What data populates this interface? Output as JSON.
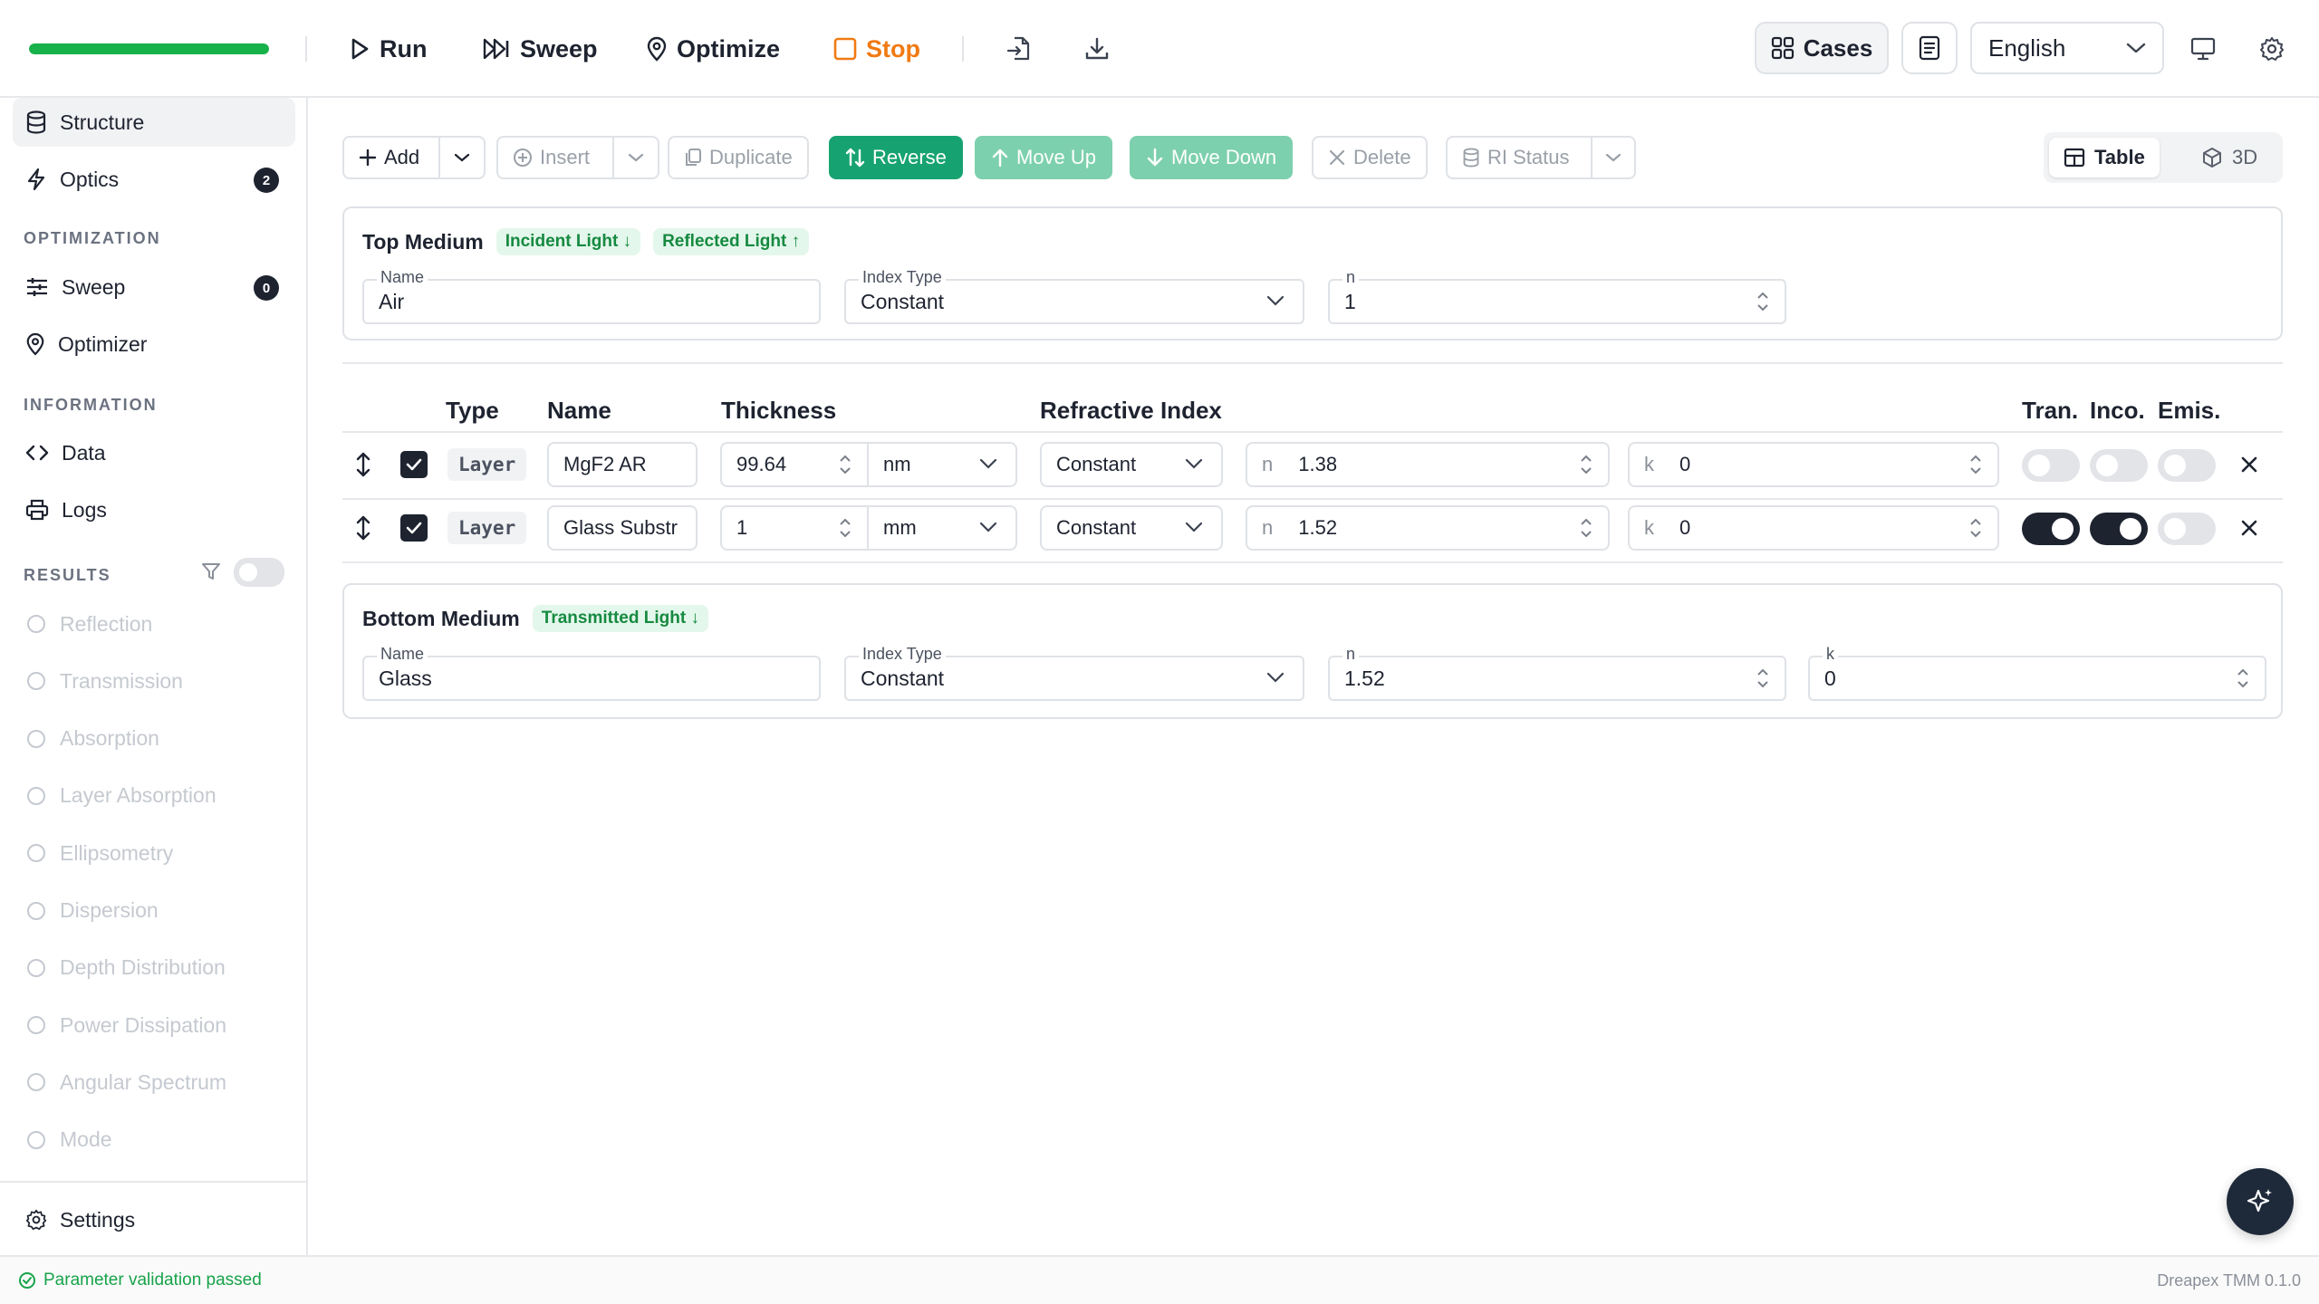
{
  "toolbar": {
    "progress": 1.0,
    "run": "Run",
    "sweep": "Sweep",
    "optimize": "Optimize",
    "stop": "Stop",
    "cases": "Cases",
    "language": "English"
  },
  "sidebar": {
    "structure": "Structure",
    "optics": "Optics",
    "optics_badge": "2",
    "section_optimization": "OPTIMIZATION",
    "sweep": "Sweep",
    "sweep_badge": "0",
    "optimizer": "Optimizer",
    "section_information": "INFORMATION",
    "data": "Data",
    "logs": "Logs",
    "section_results": "RESULTS",
    "results": [
      "Reflection",
      "Transmission",
      "Absorption",
      "Layer Absorption",
      "Ellipsometry",
      "Dispersion",
      "Depth Distribution",
      "Power Dissipation",
      "Angular Spectrum",
      "Mode"
    ],
    "settings": "Settings"
  },
  "actions": {
    "add": "Add",
    "insert": "Insert",
    "duplicate": "Duplicate",
    "reverse": "Reverse",
    "move_up": "Move Up",
    "move_down": "Move Down",
    "delete": "Delete",
    "ri_status": "RI Status",
    "table": "Table",
    "view3d": "3D"
  },
  "top_medium": {
    "title": "Top Medium",
    "tag_incident": "Incident Light ↓",
    "tag_reflected": "Reflected Light ↑",
    "name_label": "Name",
    "name": "Air",
    "index_type_label": "Index Type",
    "index_type": "Constant",
    "n_label": "n",
    "n": "1"
  },
  "table": {
    "headers": {
      "type": "Type",
      "name": "Name",
      "thickness": "Thickness",
      "ri": "Refractive Index",
      "tran": "Tran.",
      "inco": "Inco.",
      "emis": "Emis."
    },
    "rows": [
      {
        "type": "Layer",
        "name": "MgF2 AR",
        "thickness": "99.64",
        "unit": "nm",
        "index_type": "Constant",
        "n_label": "n",
        "n": "1.38",
        "k_label": "k",
        "k": "0",
        "tran": false,
        "inco": false,
        "emis": false
      },
      {
        "type": "Layer",
        "name": "Glass Substr",
        "thickness": "1",
        "unit": "mm",
        "index_type": "Constant",
        "n_label": "n",
        "n": "1.52",
        "k_label": "k",
        "k": "0",
        "tran": true,
        "inco": true,
        "emis": false
      }
    ]
  },
  "bottom_medium": {
    "title": "Bottom Medium",
    "tag_transmitted": "Transmitted Light ↓",
    "name_label": "Name",
    "name": "Glass",
    "index_type_label": "Index Type",
    "index_type": "Constant",
    "n_label": "n",
    "n": "1.52",
    "k_label": "k",
    "k": "0"
  },
  "status": {
    "message": "Parameter validation passed",
    "version": "Dreapex TMM 0.1.0"
  },
  "colors": {
    "accent_green": "#17a371",
    "progress_green": "#17b24a",
    "stop_orange": "#f07a13"
  }
}
